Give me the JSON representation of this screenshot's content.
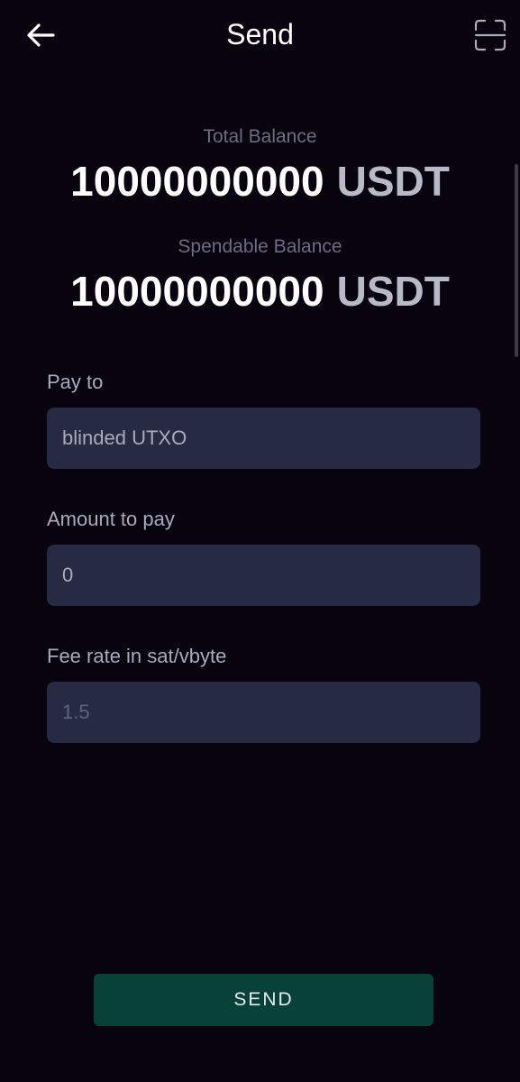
{
  "header": {
    "title": "Send",
    "back_icon": "arrow-left-icon",
    "scan_icon": "scan-frame-icon"
  },
  "balances": {
    "total": {
      "label": "Total Balance",
      "amount": "10000000000",
      "unit": "USDT"
    },
    "spendable": {
      "label": "Spendable Balance",
      "amount": "10000000000",
      "unit": "USDT"
    }
  },
  "form": {
    "pay_to": {
      "label": "Pay to",
      "value": "",
      "placeholder": "blinded UTXO"
    },
    "amount": {
      "label": "Amount to pay",
      "value": "",
      "placeholder": "0"
    },
    "fee_rate": {
      "label": "Fee rate in sat/vbyte",
      "value": "",
      "placeholder": "1.5"
    }
  },
  "actions": {
    "send_label": "SEND"
  },
  "colors": {
    "background": "#07040f",
    "input_background": "#262b43",
    "button_background": "#074139",
    "muted_text": "#6c6d80",
    "label_text": "#a9abbd",
    "unit_text": "#b9bac7"
  }
}
